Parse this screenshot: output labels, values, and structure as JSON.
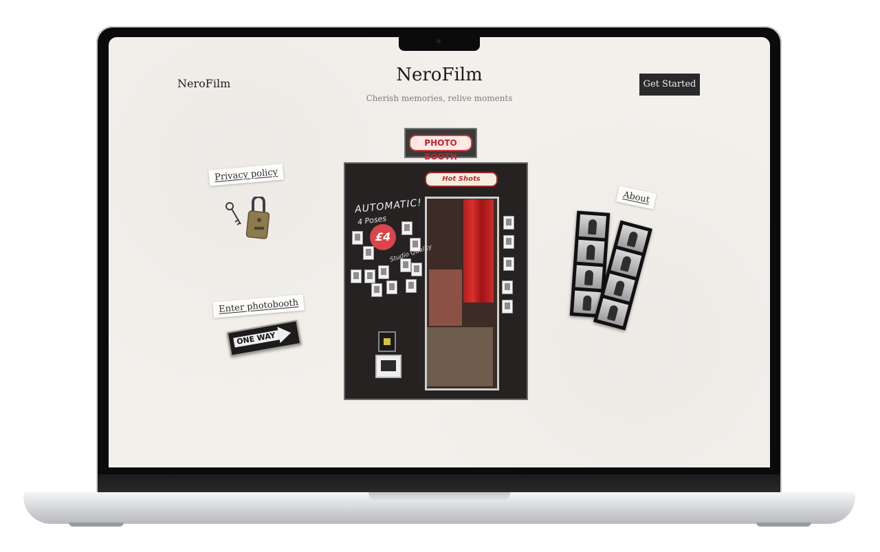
{
  "header": {
    "brand": "NeroFilm",
    "title": "NeroFilm",
    "tagline": "Cherish memories, relive moments",
    "cta_label": "Get Started"
  },
  "links": {
    "privacy": "Privacy policy",
    "enter": "Enter photobooth",
    "about": "About"
  },
  "props": {
    "sign_text": "ONE WAY",
    "booth_marquee": "PHOTO BOOTH",
    "booth_header": "Hot Shots",
    "booth_automatic": "AUTOMATIC!",
    "booth_poses": "4 Poses",
    "booth_price": "£4",
    "booth_studio": "Studio Quality"
  },
  "colors": {
    "background": "#f3f0ec",
    "button": "#2a2a2a",
    "curtain": "#c0252d"
  },
  "icons": [
    "lock-and-key-icon",
    "one-way-sign-icon",
    "photo-booth-image",
    "film-strip-image"
  ]
}
